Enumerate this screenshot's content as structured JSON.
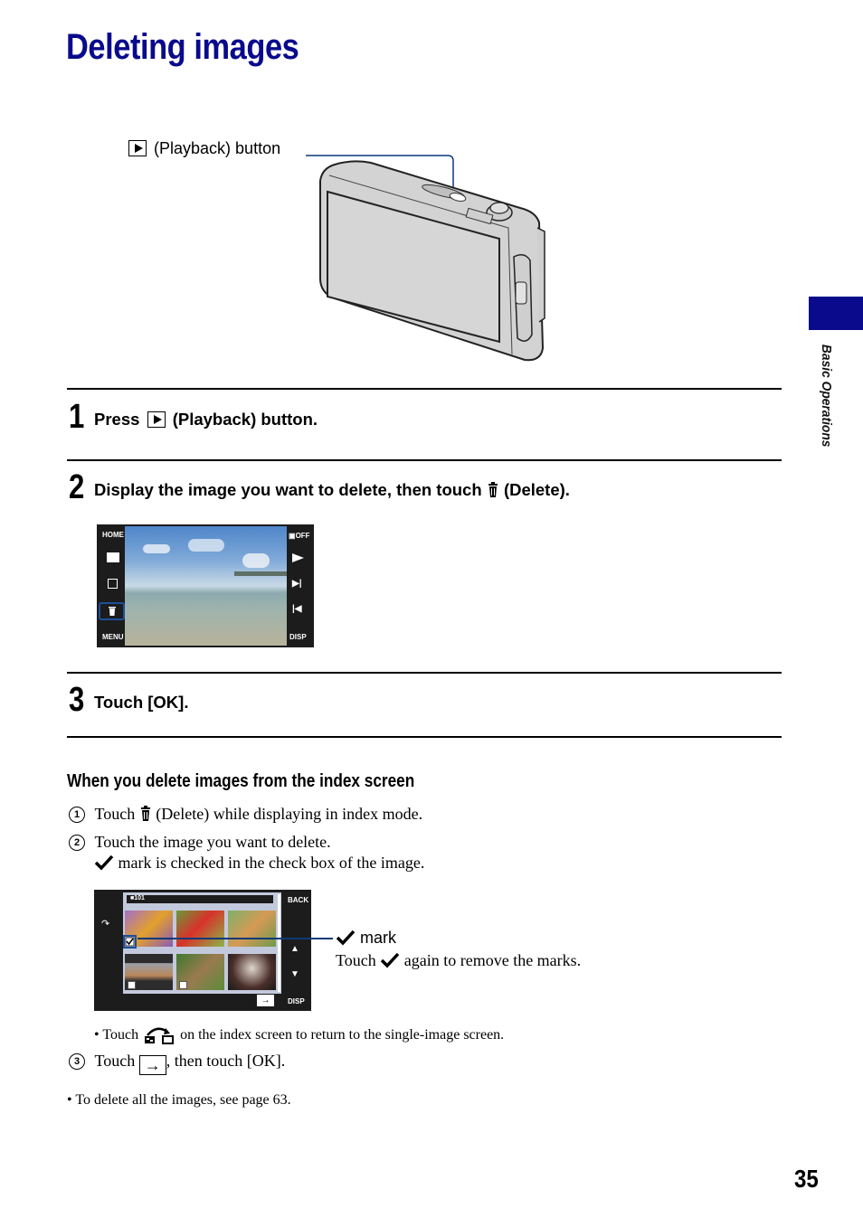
{
  "page": {
    "title": "Deleting images",
    "section_tab": "Basic Operations",
    "page_number": "35",
    "accent_color": "#0a0a8c"
  },
  "illustration": {
    "callout_label": "(Playback) button",
    "callout_icon": "playback-icon"
  },
  "steps": [
    {
      "number": "1",
      "text_before": "Press",
      "icon": "playback-icon",
      "text_after": "(Playback) button."
    },
    {
      "number": "2",
      "text_before": "Display the image you want to delete, then touch",
      "icon": "trash-icon",
      "text_after": "(Delete)."
    },
    {
      "number": "3",
      "text_before": "Touch [OK].",
      "icon": "",
      "text_after": ""
    }
  ],
  "single_screen": {
    "left_buttons": [
      "HOME",
      "index-icon",
      "slideshow-icon",
      "delete-icon",
      "MENU"
    ],
    "right_buttons": [
      "OFF",
      "play-icon",
      "next-icon",
      "prev-icon",
      "DISP"
    ],
    "left_labels": {
      "home": "HOME",
      "menu": "MENU"
    },
    "right_labels": {
      "off": "OFF",
      "disp": "DISP"
    }
  },
  "index_section": {
    "heading": "When you delete images from the index screen",
    "items": [
      {
        "marker": "1",
        "before": "Touch",
        "icon": "trash-icon",
        "after": "(Delete) while displaying in index mode."
      },
      {
        "marker": "2",
        "text": "Touch the image you want to delete.",
        "sub": "mark is checked in the check box of the image."
      }
    ],
    "index_screen": {
      "folder": "101",
      "back_label": "BACK",
      "disp_label": "DISP"
    },
    "mark_callout": {
      "label": "mark",
      "text_before": "Touch",
      "text_after": "again to remove the marks."
    },
    "bullet_return": {
      "before": "• Touch",
      "after": "on the index screen to return to the single-image screen."
    },
    "item3": {
      "marker": "3",
      "before": "Touch",
      "after": ", then touch [OK]."
    },
    "note": "• To delete all the images, see page 63."
  }
}
